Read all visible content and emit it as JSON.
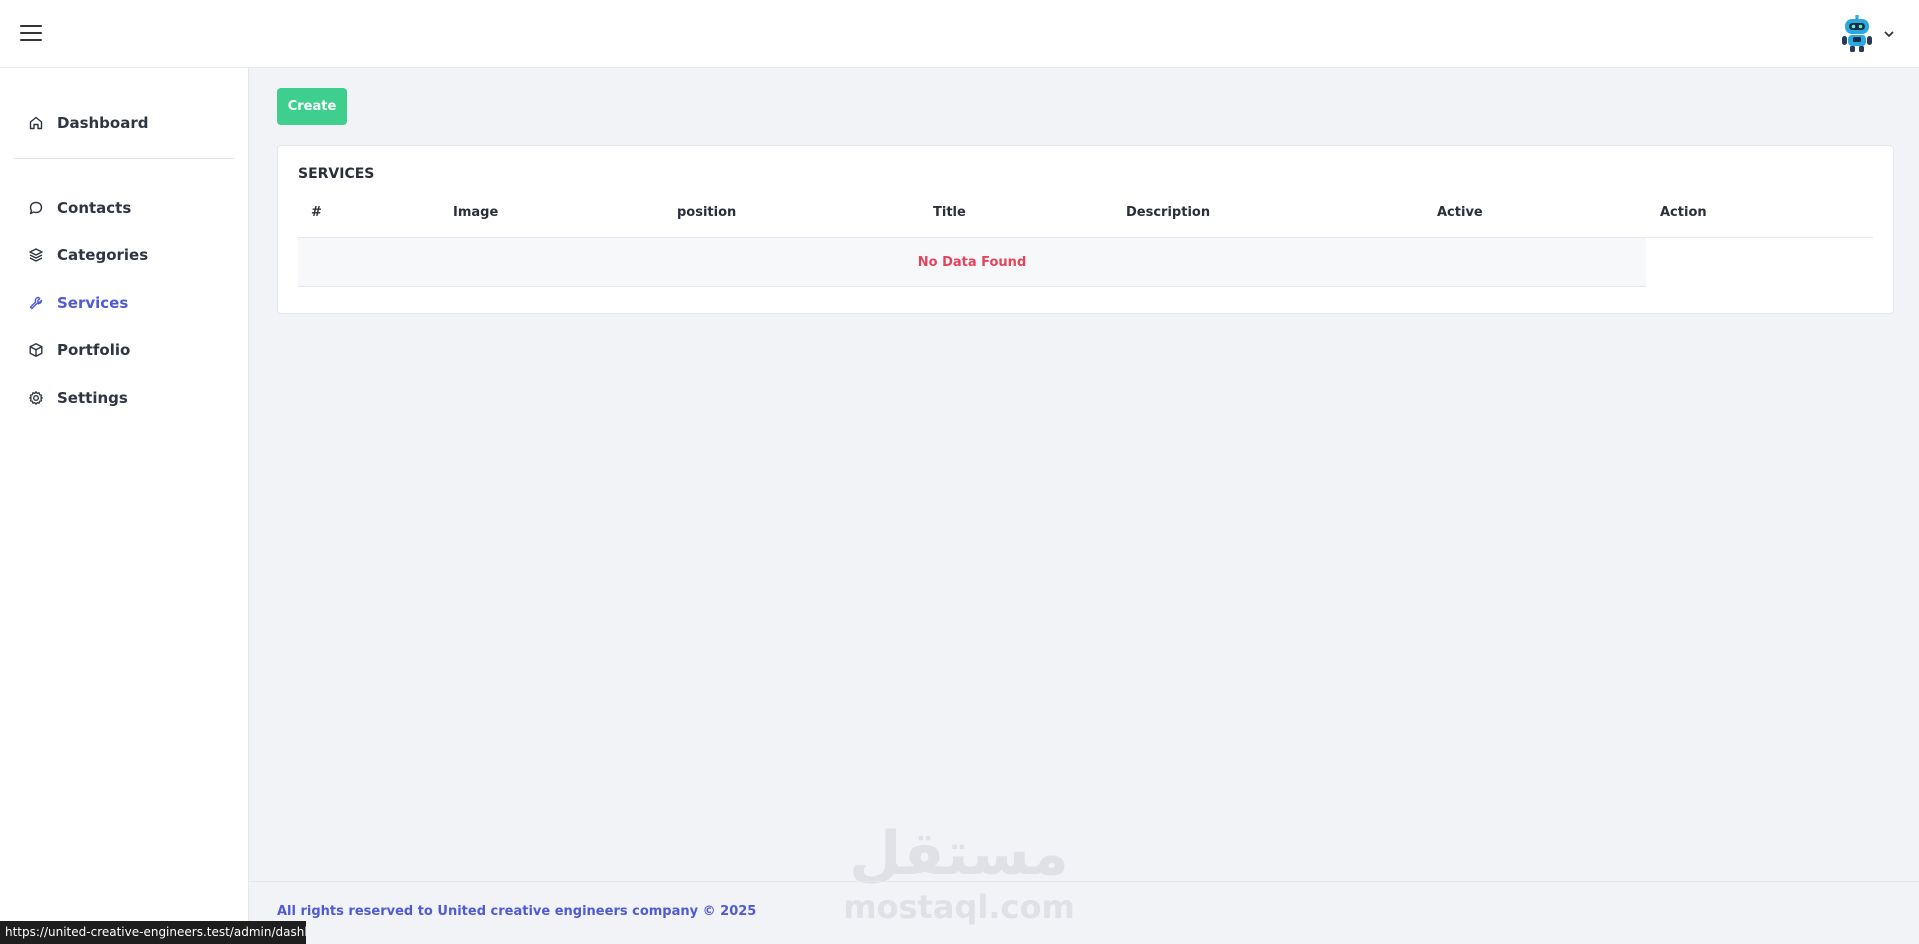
{
  "sidebar": {
    "items": [
      {
        "label": "Dashboard",
        "icon": "home-icon"
      },
      {
        "label": "Contacts",
        "icon": "chat-icon"
      },
      {
        "label": "Categories",
        "icon": "layers-icon"
      },
      {
        "label": "Services",
        "icon": "wrench-icon",
        "active": true
      },
      {
        "label": "Portfolio",
        "icon": "box-icon"
      },
      {
        "label": "Settings",
        "icon": "gear-icon"
      }
    ]
  },
  "main": {
    "create_label": "Create",
    "card_title": "SERVICES",
    "columns": [
      "#",
      "Image",
      "position",
      "Title",
      "Description",
      "Active",
      "Action"
    ],
    "empty_message": "No Data Found"
  },
  "footer": {
    "text": "All rights reserved to United creative engineers company © 2025"
  },
  "watermark": {
    "logo": "مستقل",
    "site": "mostaql.com"
  },
  "status_url": "https://united-creative-engineers.test/admin/dashboard",
  "colors": {
    "accent": "#4f5bd5",
    "create_button": "#3ecf8e",
    "empty_text": "#e5435b",
    "background": "#f1f3f7"
  }
}
